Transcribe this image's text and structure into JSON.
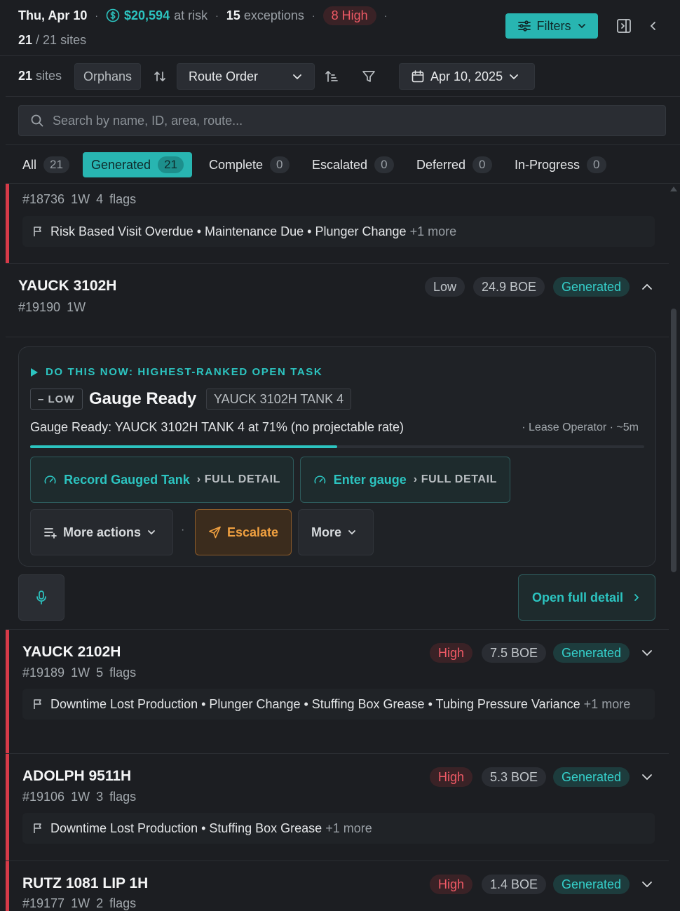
{
  "header": {
    "date": "Thu, Apr 10",
    "money": "$20,594",
    "money_suffix": "at risk",
    "exceptions_count": "15",
    "exceptions_label": "exceptions",
    "high_label": "8 High",
    "sites_count": "21",
    "sites_total": "/ 21 sites",
    "filters_label": "Filters"
  },
  "toolbar": {
    "sites_count": "21",
    "sites_label": "sites",
    "orphans_label": "Orphans",
    "sort_value": "Route Order",
    "date_value": "Apr 10, 2025"
  },
  "search": {
    "placeholder": "Search by name, ID, area, route..."
  },
  "tabs": [
    {
      "label": "All",
      "count": "21"
    },
    {
      "label": "Generated",
      "count": "21"
    },
    {
      "label": "Complete",
      "count": "0"
    },
    {
      "label": "Escalated",
      "count": "0"
    },
    {
      "label": "Deferred",
      "count": "0"
    },
    {
      "label": "In-Progress",
      "count": "0"
    }
  ],
  "sites": [
    {
      "meta": "#18736  1W  4 flags",
      "flags": "Risk Based Visit Overdue • Maintenance Due • Plunger Change",
      "more": "+1 more"
    },
    {
      "name": "YAUCK 3102H",
      "meta": "#19190  1W",
      "priority": "Low",
      "boe": "24.9 BOE",
      "status": "Generated",
      "task": {
        "do_now": "DO THIS NOW: HIGHEST-RANKED OPEN TASK",
        "priority": "– LOW",
        "title": "Gauge Ready",
        "tank": "YAUCK 3102H TANK 4",
        "description": "Gauge Ready: YAUCK 3102H TANK 4 at 71% (no projectable rate)",
        "owner": "· Lease Operator · ~5m",
        "progress": 0.5,
        "action1_label": "Record Gauged Tank",
        "action1_sub": "› FULL DETAIL",
        "action2_label": "Enter gauge",
        "action2_sub": "› FULL DETAIL",
        "more_actions_label": "More actions",
        "separator": "·",
        "escalate_label": "Escalate",
        "more_label": "More",
        "open_detail_label": "Open full detail"
      }
    },
    {
      "name": "YAUCK 2102H",
      "meta": "#19189  1W  5 flags",
      "priority": "High",
      "boe": "7.5 BOE",
      "status": "Generated",
      "flags": "Downtime Lost Production • Plunger Change • Stuffing Box Grease • Tubing Pressure Variance",
      "more": "+1 more"
    },
    {
      "name": "ADOLPH 9511H",
      "meta": "#19106  1W  3 flags",
      "priority": "High",
      "boe": "5.3 BOE",
      "status": "Generated",
      "flags": "Downtime Lost Production • Stuffing Box Grease",
      "more": "+1 more"
    },
    {
      "name": "RUTZ 1081 LIP 1H",
      "meta": "#19177  1W  2 flags",
      "priority": "High",
      "boe": "1.4 BOE",
      "status": "Generated"
    }
  ],
  "colors": {
    "accent": "#2cc4c0",
    "high": "#f05a66",
    "escalate": "#f0a040",
    "background": "#1c1e22"
  }
}
